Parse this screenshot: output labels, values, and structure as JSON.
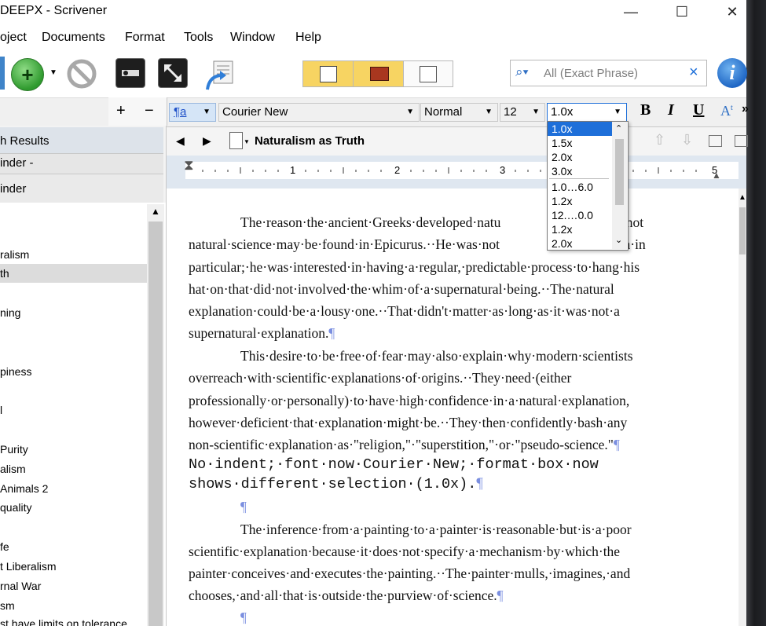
{
  "window": {
    "title": "DEEPX - Scrivener",
    "minimize": "—",
    "maximize": "☐",
    "close": "✕"
  },
  "menu": [
    "oject",
    "Documents",
    "Format",
    "Tools",
    "Window",
    "Help"
  ],
  "toolbar": {
    "search_placeholder": "All (Exact Phrase)",
    "search_clear": "×",
    "info": "i"
  },
  "split_bar": {
    "add": "+",
    "remove": "−"
  },
  "format": {
    "paragraph_style": "¶a",
    "font": "Courier New",
    "typeface": "Normal",
    "size": "12",
    "line_spacing": "1.0x",
    "bold": "B",
    "italic": "I",
    "underline": "U",
    "superscript": "A",
    "more": "»"
  },
  "line_spacing_options": [
    "1.0x",
    "1.5x",
    "2.0x",
    "3.0x",
    "1.0…6.0",
    "1.2x",
    "12.…0.0",
    "1.2x",
    "2.0x"
  ],
  "binder": {
    "search_results": "h Results",
    "binder_label": "inder -",
    "binder_label2": "inder",
    "items": [
      "ralism",
      "th",
      "ning",
      "piness",
      "l",
      "Purity",
      "alism",
      "Animals 2",
      "quality",
      "",
      "fe",
      "t Liberalism",
      "rnal War",
      "sm",
      "st have limits on tolerance"
    ]
  },
  "editor": {
    "document_title": "Naturalism as Truth",
    "ruler_numbers": [
      "1",
      "2",
      "3",
      "5"
    ],
    "paragraphs": [
      "The·reason·the·ancient·Greeks·developed·natu",
      "ay·and·not",
      "natural·science·may·be·found·in·Epicurus.··He·was·not",
      "the·truth·in",
      "particular;·he·was·interested·in·having·a·regular,·predictable·process·to·hang·his",
      "hat·on·that·did·not·involved·the·whim·of·a·supernatural·being.··The·natural",
      "explanation·could·be·a·lousy·one.··That·didn't·matter·as·long·as·it·was·not·a",
      "supernatural·explanation.",
      "This·desire·to·be·free·of·fear·may·also·explain·why·modern·scientists",
      "overreach·with·scientific·explanations·of·origins.··They·need·(either",
      "professionally·or·personally)·to·have·high·confidence·in·a·natural·explanation,",
      "however·deficient·that·explanation·might·be.··They·then·confidently·bash·any",
      "non-scientific·explanation·as·\"religion,\"·\"superstition,\"·or·\"pseudo-science.\"",
      "No·indent;·font·now·Courier·New;·format·box·now",
      "shows·different·selection·(1.0x).",
      "The·inference·from·a·painting·to·a·painter·is·reasonable·but·is·a·poor",
      "scientific·explanation·because·it·does·not·specify·a·mechanism·by·which·the",
      "painter·conceives·and·executes·the·painting.··The·painter·mulls,·imagines,·and",
      "chooses,·and·all·that·is·outside·the·purview·of·science."
    ],
    "pilcrow": "¶"
  },
  "colors": {
    "accent_blue": "#1e6fd9",
    "selection": "#1e6fd9",
    "green_add": "#3cab3a",
    "pilcrow": "#7b8fe0"
  }
}
